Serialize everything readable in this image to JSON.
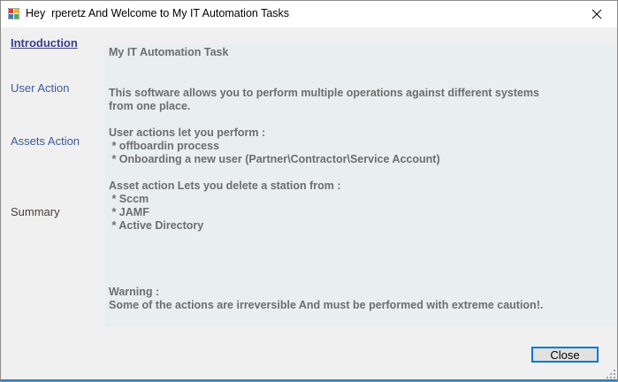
{
  "window": {
    "title": "Hey  rperetz And Welcome to My IT Automation Tasks",
    "icon": "app-window-icon",
    "close_icon": "close-icon"
  },
  "nav": {
    "introduction": "Introduction",
    "user_action": "User Action",
    "assets_action": "Assets Action",
    "summary": "Summary"
  },
  "content": {
    "heading": "My IT Automation Task",
    "intro": "This software allows you to perform multiple operations against different systems\nfrom one place.",
    "user_actions": "User actions let you perform :\n * offboardin process\n * Onboarding a new user (Partner\\Contractor\\Service Account)",
    "asset_actions": "Asset action Lets you delete a station from :\n * Sccm\n * JAMF\n * Active Directory",
    "warning": "Warning :\nSome of the actions are irreversible And must be performed with extreme caution!."
  },
  "footer": {
    "close_label": "Close"
  },
  "colors": {
    "accent": "#0078d7",
    "panel_bg": "#e9eef0",
    "client_bg": "#f0f0f0",
    "nav_link": "#3b5a9e"
  }
}
